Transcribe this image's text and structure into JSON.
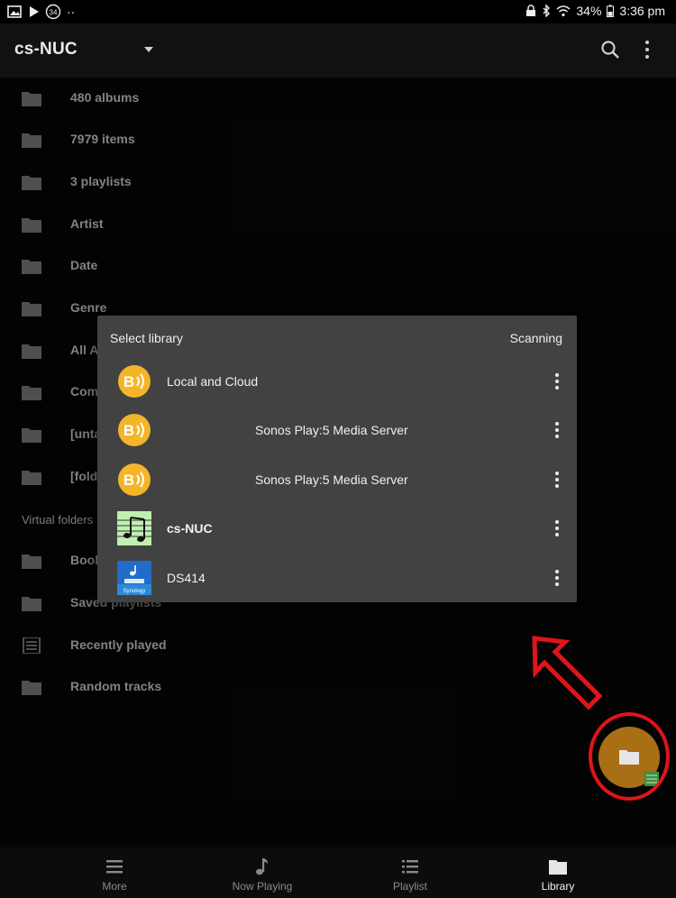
{
  "statusbar": {
    "battery": "34%",
    "time": "3:36 pm",
    "notification_count": "34"
  },
  "appbar": {
    "title": "cs-NUC"
  },
  "list": {
    "items": [
      {
        "label": "480 albums",
        "icon": "folder-icon"
      },
      {
        "label": "7979 items",
        "icon": "folder-icon"
      },
      {
        "label": "3 playlists",
        "icon": "folder-icon"
      },
      {
        "label": "Artist",
        "icon": "folder-icon"
      },
      {
        "label": "Date",
        "icon": "folder-icon"
      },
      {
        "label": "Genre",
        "icon": "folder-icon"
      },
      {
        "label": "All A",
        "icon": "folder-icon"
      },
      {
        "label": "Com",
        "icon": "folder-icon"
      },
      {
        "label": "[unta",
        "icon": "folder-icon"
      },
      {
        "label": "[folde",
        "icon": "folder-icon"
      }
    ],
    "virtual_section": "Virtual folders",
    "virtual_items": [
      {
        "label": "Book",
        "icon": "folder-icon"
      },
      {
        "label": "Saved playlists",
        "icon": "folder-icon"
      },
      {
        "label": "Recently played",
        "icon": "list-icon"
      },
      {
        "label": "Random tracks",
        "icon": "folder-icon"
      }
    ]
  },
  "dialog": {
    "title": "Select library",
    "status": "Scanning",
    "items": [
      {
        "label": "Local and Cloud",
        "icon": "bubbleupnp-icon"
      },
      {
        "label": "Sonos Play:5 Media Server",
        "icon": "bubbleupnp-icon"
      },
      {
        "label": "Sonos Play:5 Media Server",
        "icon": "bubbleupnp-icon"
      },
      {
        "label": "cs-NUC",
        "icon": "music-note-icon",
        "selected": true
      },
      {
        "label": "DS414",
        "icon": "synology-icon"
      }
    ],
    "synology_text": "Synology"
  },
  "navbar": {
    "items": [
      {
        "label": "More",
        "icon": "menu-icon"
      },
      {
        "label": "Now Playing",
        "icon": "music-note-icon"
      },
      {
        "label": "Playlist",
        "icon": "playlist-icon"
      },
      {
        "label": "Library",
        "icon": "folder-icon",
        "active": true
      }
    ]
  },
  "colors": {
    "accent": "#a86f14",
    "highlight_ring": "#e0141b",
    "dialog_bg": "#424242"
  }
}
